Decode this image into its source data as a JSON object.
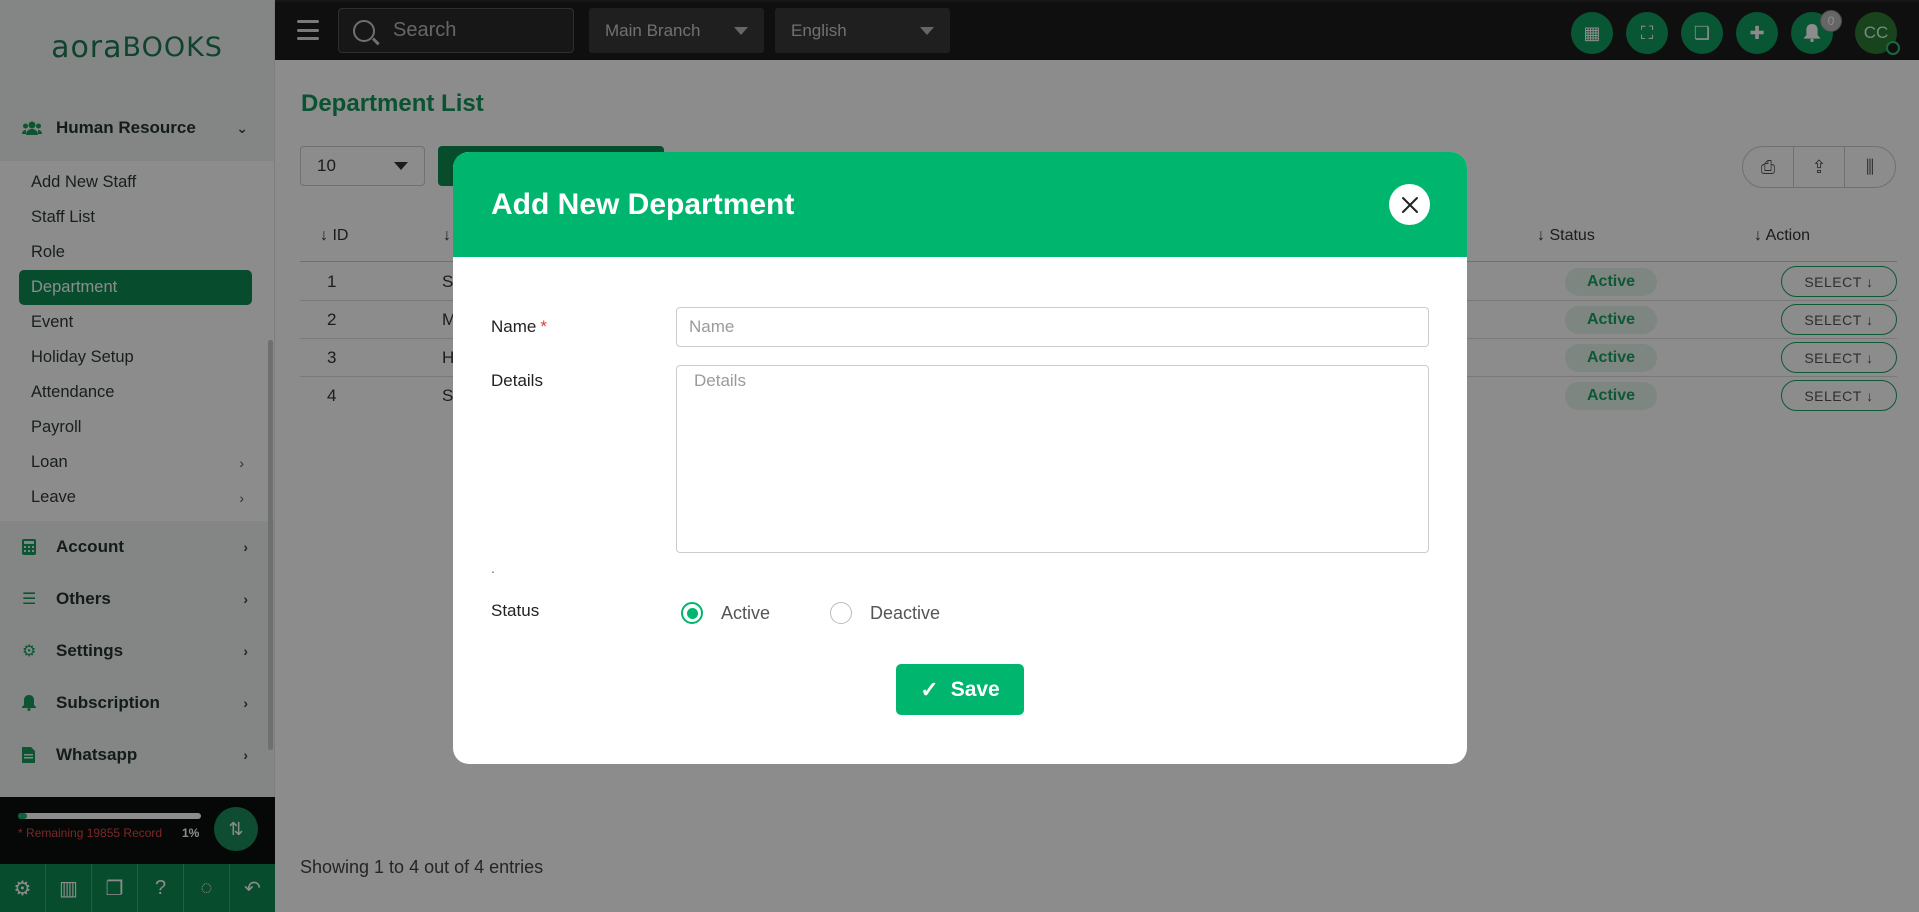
{
  "brand": {
    "logo_left": "aora",
    "logo_right": "BOOKS",
    "accent": "#00b66e",
    "dark_green": "#0f8a54"
  },
  "sidebar": {
    "hr_group": "Human Resource",
    "hr_items": [
      {
        "label": "Add New Staff"
      },
      {
        "label": "Staff List"
      },
      {
        "label": "Role"
      },
      {
        "label": "Department"
      },
      {
        "label": "Event"
      },
      {
        "label": "Holiday Setup"
      },
      {
        "label": "Attendance"
      },
      {
        "label": "Payroll"
      },
      {
        "label": "Loan"
      },
      {
        "label": "Leave"
      }
    ],
    "groups": [
      {
        "label": "Account"
      },
      {
        "label": "Others"
      },
      {
        "label": "Settings"
      },
      {
        "label": "Subscription"
      },
      {
        "label": "Whatsapp"
      }
    ],
    "record_remaining": "* Remaining 19855 Record",
    "record_pct": "1%",
    "record_progress": 0.01
  },
  "topbar": {
    "search_placeholder": "Search",
    "branch": "Main Branch",
    "language": "English",
    "notification_count": "0",
    "avatar_initials": "CC"
  },
  "page": {
    "title": "Department List",
    "per_page": "10",
    "columns": {
      "id": "ID",
      "status": "Status",
      "action": "Action"
    },
    "rows": [
      {
        "id": "1",
        "name": "S",
        "status": "Active",
        "action": "SELECT"
      },
      {
        "id": "2",
        "name": "M",
        "status": "Active",
        "action": "SELECT"
      },
      {
        "id": "3",
        "name": "H",
        "status": "Active",
        "action": "SELECT"
      },
      {
        "id": "4",
        "name": "S",
        "status": "Active",
        "action": "SELECT"
      }
    ],
    "showing": "Showing 1 to 4 out of 4 entries"
  },
  "modal": {
    "title": "Add New Department",
    "name_label": "Name",
    "required_mark": "*",
    "name_placeholder": "Name",
    "details_label": "Details",
    "details_placeholder": "Details",
    "dot": ".",
    "status_label": "Status",
    "status_options": [
      "Active",
      "Deactive"
    ],
    "status_selected": "Active",
    "save_label": "Save"
  }
}
